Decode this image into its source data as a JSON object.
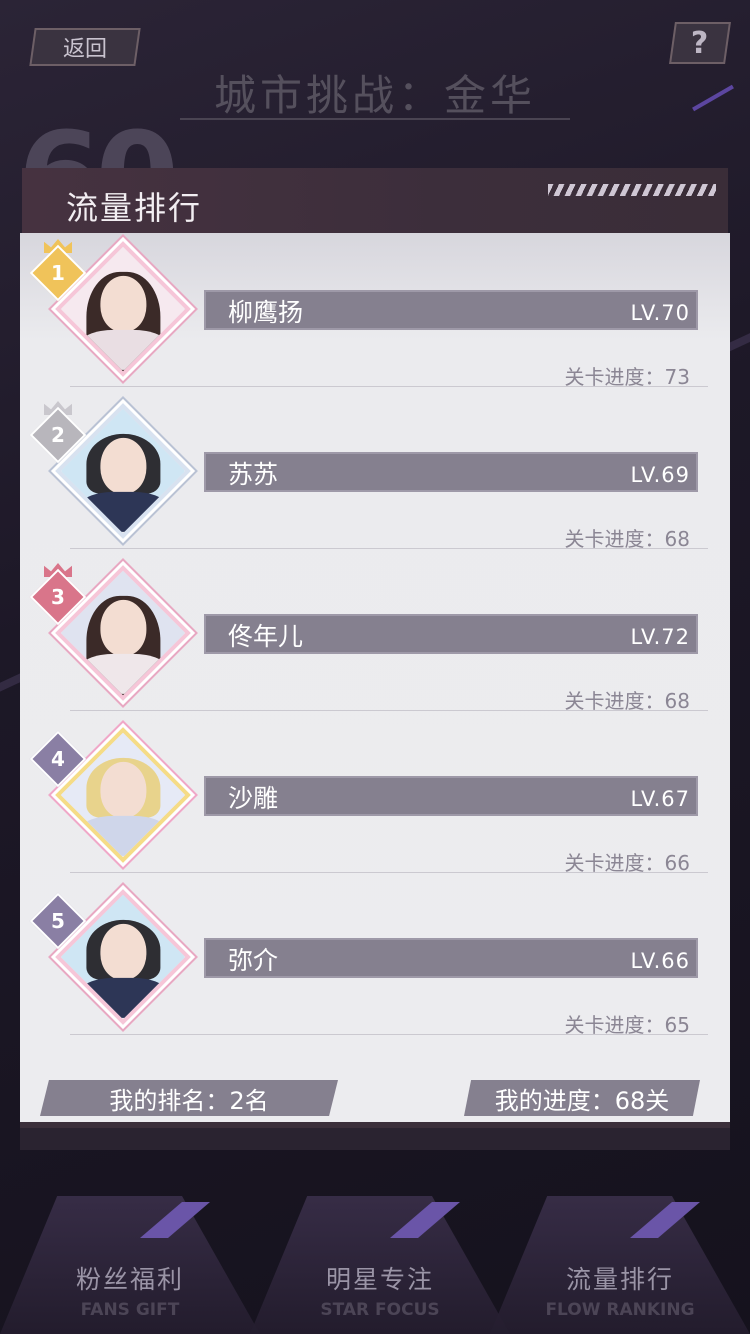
{
  "header": {
    "back_label": "返回",
    "help_label": "?",
    "city_title": "城市挑战：金华",
    "bg_number": "60"
  },
  "panel": {
    "title": "流量排行"
  },
  "ranking": [
    {
      "rank": "1",
      "name": "柳鹰扬",
      "level": "LV.70",
      "progress": "关卡进度：73"
    },
    {
      "rank": "2",
      "name": "苏苏",
      "level": "LV.69",
      "progress": "关卡进度：68"
    },
    {
      "rank": "3",
      "name": "佟年儿",
      "level": "LV.72",
      "progress": "关卡进度：68"
    },
    {
      "rank": "4",
      "name": "沙雕",
      "level": "LV.67",
      "progress": "关卡进度：66"
    },
    {
      "rank": "5",
      "name": "弥介",
      "level": "LV.66",
      "progress": "关卡进度：65"
    }
  ],
  "footer": {
    "my_rank": "我的排名：2名",
    "my_progress": "我的进度：68关"
  },
  "tabs": [
    {
      "label": "粉丝福利",
      "sub": "FANS GIFT"
    },
    {
      "label": "明星专注",
      "sub": "STAR FOCUS"
    },
    {
      "label": "流量排行",
      "sub": "FLOW RANKING"
    }
  ],
  "colors": {
    "rank_1": "#f0c35a",
    "rank_2": "#b8b6bc",
    "rank_3": "#d9758a",
    "rank_other": "#8a7fa4",
    "name_bar": "#85808f",
    "accent_purple": "#6a55a8"
  }
}
